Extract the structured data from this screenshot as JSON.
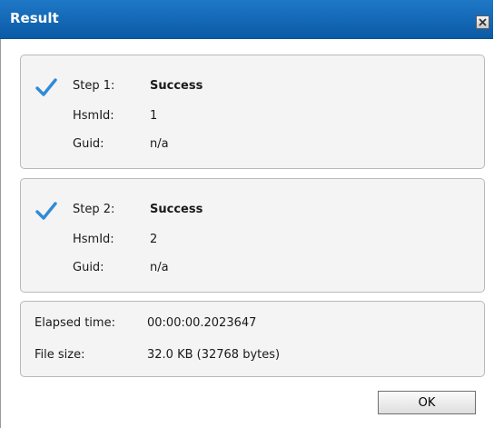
{
  "window": {
    "title": "Result",
    "colors": {
      "titlebar": "#0f66b5",
      "check": "#2f8bd6"
    }
  },
  "steps": [
    {
      "step_label": "Step 1:",
      "status": "Success",
      "hsmid_label": "HsmId:",
      "hsmid_value": "1",
      "guid_label": "Guid:",
      "guid_value": "n/a",
      "icon": "checkmark-icon"
    },
    {
      "step_label": "Step 2:",
      "status": "Success",
      "hsmid_label": "HsmId:",
      "hsmid_value": "2",
      "guid_label": "Guid:",
      "guid_value": "n/a",
      "icon": "checkmark-icon"
    }
  ],
  "summary": {
    "elapsed_label": "Elapsed time:",
    "elapsed_value": "00:00:00.2023647",
    "filesize_label": "File size:",
    "filesize_value": "32.0 KB (32768 bytes)"
  },
  "buttons": {
    "ok_label": "OK"
  }
}
